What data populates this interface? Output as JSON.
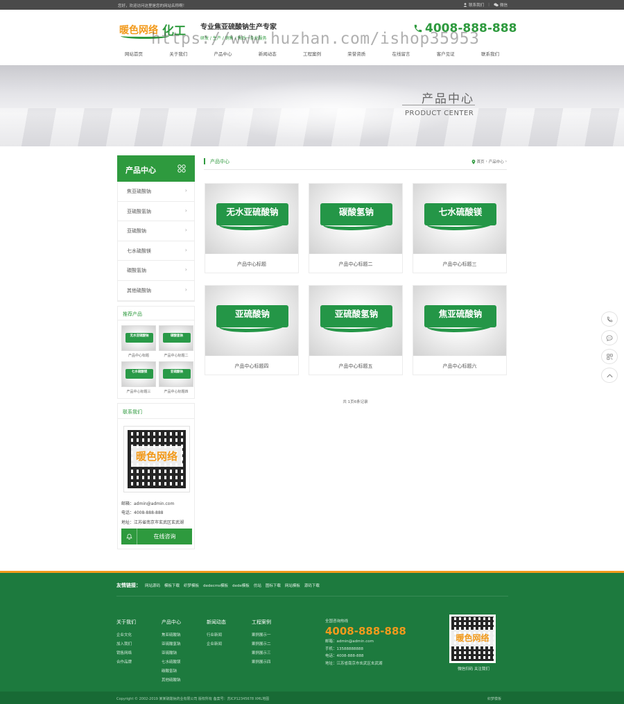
{
  "topbar": {
    "welcome": "您好，欢迎访问这里是您的网站名称啊！",
    "member": "联系我们",
    "wechat": "微信"
  },
  "header": {
    "logo_text": "暖色网络",
    "logo_brand": "化工",
    "slogan_title": "专业焦亚硫酸钠生产专家",
    "slogan_sub": "研发 / 生产 / 销售 / 售后一条龙服务",
    "hotline": "4008-888-888",
    "watermark": "https://www.huzhan.com/ishop35953"
  },
  "nav": [
    "网站首页",
    "关于我们",
    "产品中心",
    "新闻动态",
    "工程案例",
    "荣誉资质",
    "在线留言",
    "客户见证",
    "联系我们"
  ],
  "banner": {
    "title": "产品中心",
    "subtitle": "PRODUCT CENTER"
  },
  "sidebar": {
    "heading": "产品中心",
    "items": [
      "焦亚硫酸钠",
      "亚硫酸氢钠",
      "亚硫酸钠",
      "七水硫酸镁",
      "碳酸氢钠",
      "其他硫酸钠"
    ],
    "recommend_title": "推荐产品",
    "recommend": [
      {
        "badge": "无水亚硫酸钠",
        "caption": "产品中心标题"
      },
      {
        "badge": "碳酸氢钠",
        "caption": "产品中心标题二"
      },
      {
        "badge": "七水硫酸镁",
        "caption": "产品中心标题三"
      },
      {
        "badge": "亚硫酸钠",
        "caption": "产品中心标题四"
      }
    ],
    "contact_title": "联系我们",
    "qr_mark": "暖色网络",
    "email": "邮箱：admin@admin.com",
    "phone": "电话：4008-888-888",
    "address": "地址：江苏省南京市玄武区玄武湖",
    "consult": "在线咨询"
  },
  "main": {
    "title": "产品中心",
    "breadcrumb_home": "首页",
    "breadcrumb_sep": "›",
    "breadcrumb_current": "产品中心",
    "products": [
      {
        "badge": "无水亚硫酸钠",
        "caption": "产品中心标题"
      },
      {
        "badge": "碳酸氢钠",
        "caption": "产品中心标题二"
      },
      {
        "badge": "七水硫酸镁",
        "caption": "产品中心标题三"
      },
      {
        "badge": "亚硫酸钠",
        "caption": "产品中心标题四"
      },
      {
        "badge": "亚硫酸氢钠",
        "caption": "产品中心标题五"
      },
      {
        "badge": "焦亚硫酸钠",
        "caption": "产品中心标题六"
      }
    ],
    "pager": "共 1页6条记录"
  },
  "footer": {
    "links_label": "友情链接：",
    "links": [
      "网站源码",
      "模板下载",
      "织梦模板",
      "dedecms模板",
      "dede模板",
      "仿站",
      "图标下载",
      "网站模板",
      "源码下载"
    ],
    "columns": [
      {
        "title": "关于我们",
        "items": [
          "企业文化",
          "加入我们",
          "销售网络",
          "合作品牌"
        ]
      },
      {
        "title": "产品中心",
        "items": [
          "焦亚硫酸钠",
          "亚硫酸氢钠",
          "亚硫酸钠",
          "七水硫酸镁",
          "碳酸氢钠",
          "其他硫酸钠"
        ]
      },
      {
        "title": "新闻动态",
        "items": [
          "行业新闻",
          "企业新闻"
        ]
      },
      {
        "title": "工程案例",
        "items": [
          "案例展示一",
          "案例展示二",
          "案例展示三",
          "案例展示四"
        ]
      }
    ],
    "hotline_label": "全国咨询热线",
    "hotline": "4008-888-888",
    "email": "邮箱：admin@admin.com",
    "mobile": "手机：13588888888",
    "phone": "电话：4008-888-888",
    "address": "地址：江苏省南京市玄武区玄武湖",
    "qr_mark": "暖色网络",
    "qr_caption": "微信扫码 关注我们",
    "copyright": "Copyright © 2002-2019 某某硫酸钠药业有限公司 版权所有   备案号：苏ICP12345678 XML地图",
    "credit": "织梦模板"
  },
  "colors": {
    "brand_green": "#2e9a3e",
    "accent_orange": "#f29a1c",
    "footer_green": "#1d7a3e"
  }
}
